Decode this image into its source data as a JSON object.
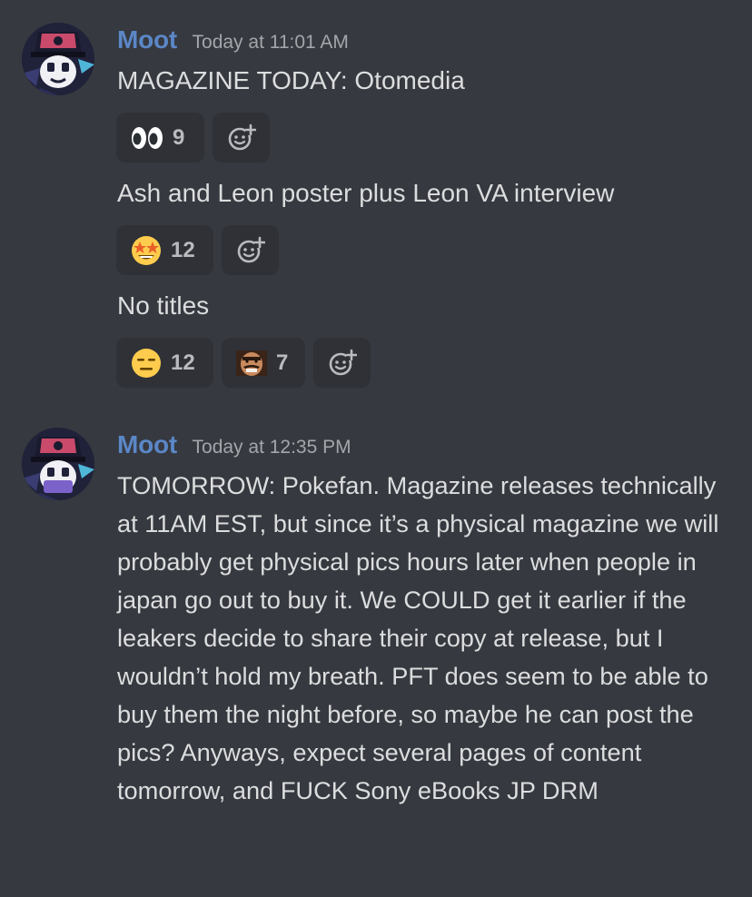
{
  "messages": [
    {
      "author": "Moot",
      "timestamp": "Today at 11:01 AM",
      "lines": [
        {
          "text": "MAGAZINE TODAY: Otomedia",
          "reactions": [
            {
              "emoji": "eyes-emoji",
              "count": "9"
            }
          ]
        },
        {
          "text": "Ash and Leon poster plus Leon VA interview",
          "reactions": [
            {
              "emoji": "star-struck-emoji",
              "count": "12"
            }
          ]
        },
        {
          "text": "No titles",
          "reactions": [
            {
              "emoji": "expressionless-emoji",
              "count": "12"
            },
            {
              "emoji": "custom-mustache-face-emoji",
              "count": "7"
            }
          ]
        }
      ]
    },
    {
      "author": "Moot",
      "timestamp": "Today at 12:35 PM",
      "text": "TOMORROW: Pokefan. Magazine releases technically at 11AM EST, but since it’s a physical magazine we will probably get physical pics hours later when people in japan go out to buy it. We COULD get it earlier if the leakers decide to share their copy at release, but I wouldn’t hold my breath. PFT does seem to be able to buy them the night before, so maybe he can post the pics? Anyways, expect several pages of content tomorrow, and FUCK Sony eBooks JP DRM"
    }
  ],
  "colors": {
    "background": "#36393f",
    "author": "#5b87c7",
    "text": "#dcddde",
    "timestamp": "#a3a6aa",
    "reaction_bg": "#2f3136"
  },
  "icons": {
    "add_reaction": "add-reaction-icon"
  }
}
